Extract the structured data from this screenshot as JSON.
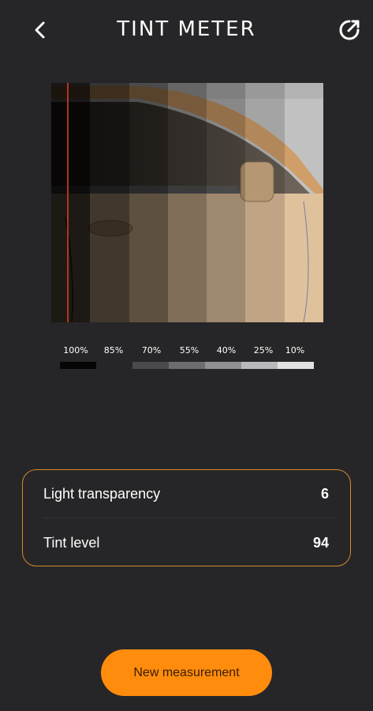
{
  "header": {
    "title": "TINT METER",
    "back_icon": "chevron-left-icon",
    "share_icon": "share-external-icon"
  },
  "preview": {
    "indicator_color": "#e5402a",
    "selected_level": "100%"
  },
  "scale": {
    "labels": [
      "100%",
      "85%",
      "70%",
      "55%",
      "40%",
      "25%",
      "10%"
    ],
    "bar_colors": [
      "#050505",
      "#262628",
      "#4a4a4c",
      "#6d6d6f",
      "#909092",
      "#b9b9bb",
      "#e2e2e2"
    ]
  },
  "results": {
    "light_transparency_label": "Light transparency",
    "light_transparency_value": "6",
    "tint_level_label": "Tint level",
    "tint_level_value": "94",
    "border_color": "#d58a2a"
  },
  "actions": {
    "new_measurement_label": "New measurement",
    "button_color": "#ff8c0c"
  }
}
